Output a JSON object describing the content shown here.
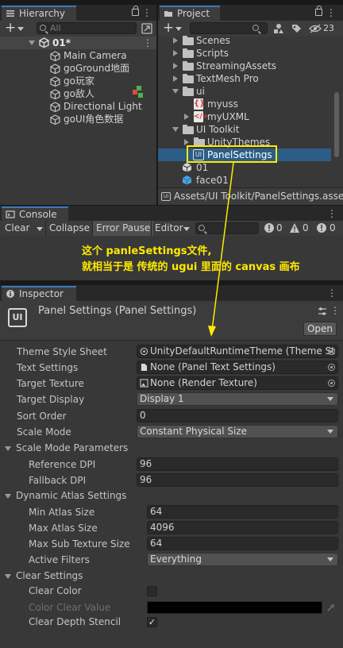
{
  "hierarchy": {
    "tab_label": "Hierarchy",
    "search_placeholder": "All",
    "scene": "01*",
    "objects": [
      {
        "label": "Main Camera"
      },
      {
        "label": "goGround地面"
      },
      {
        "label": "go玩家"
      },
      {
        "label": "go敌人"
      },
      {
        "label": "Directional Light"
      },
      {
        "label": "goUI角色数据"
      }
    ]
  },
  "project": {
    "tab_label": "Project",
    "hidden_count": "23",
    "items": [
      {
        "label": "Scenes",
        "kind": "folder"
      },
      {
        "label": "Scripts",
        "kind": "folder"
      },
      {
        "label": "StreamingAssets",
        "kind": "folder"
      },
      {
        "label": "TextMesh Pro",
        "kind": "folder"
      },
      {
        "label": "ui",
        "kind": "folder"
      },
      {
        "label": "myuss",
        "kind": "uss"
      },
      {
        "label": "myUXML",
        "kind": "uxml"
      },
      {
        "label": "UI Toolkit",
        "kind": "folder"
      },
      {
        "label": "UnityThemes",
        "kind": "folder"
      },
      {
        "label": "PanelSettings",
        "kind": "panel"
      },
      {
        "label": "01",
        "kind": "scene"
      },
      {
        "label": "face01",
        "kind": "prefab"
      }
    ],
    "path": "Assets/UI Toolkit/PanelSettings.asse"
  },
  "console": {
    "tab_label": "Console",
    "clear": "Clear",
    "collapse": "Collapse",
    "error_pause": "Error Pause",
    "editor": "Editor",
    "info_count": "0",
    "warn_count": "0",
    "error_count": "0"
  },
  "annotation": {
    "line1": "这个 panleSettings文件,",
    "line2": "就相当于是 传统的 ugui 里面的 canvas 画布",
    "color": "#ffea00"
  },
  "inspector": {
    "tab_label": "Inspector",
    "title": "Panel Settings (Panel Settings)",
    "open_button": "Open",
    "theme_style_sheet": {
      "label": "Theme Style Sheet",
      "value": "UnityDefaultRuntimeTheme (Theme St"
    },
    "text_settings": {
      "label": "Text Settings",
      "value": "None (Panel Text Settings)"
    },
    "target_texture": {
      "label": "Target Texture",
      "value": "None (Render Texture)"
    },
    "target_display": {
      "label": "Target Display",
      "value": "Display 1"
    },
    "sort_order": {
      "label": "Sort Order",
      "value": "0"
    },
    "scale_mode": {
      "label": "Scale Mode",
      "value": "Constant Physical Size"
    },
    "scale_mode_params": {
      "header": "Scale Mode Parameters",
      "reference_dpi": {
        "label": "Reference DPI",
        "value": "96"
      },
      "fallback_dpi": {
        "label": "Fallback DPI",
        "value": "96"
      }
    },
    "dynamic_atlas": {
      "header": "Dynamic Atlas Settings",
      "min_atlas_size": {
        "label": "Min Atlas Size",
        "value": "64"
      },
      "max_atlas_size": {
        "label": "Max Atlas Size",
        "value": "4096"
      },
      "max_sub_texture_size": {
        "label": "Max Sub Texture Size",
        "value": "64"
      },
      "active_filters": {
        "label": "Active Filters",
        "value": "Everything"
      }
    },
    "clear_settings": {
      "header": "Clear Settings",
      "clear_color": {
        "label": "Clear Color",
        "checked": false
      },
      "color_clear_value": {
        "label": "Color Clear Value",
        "color": "#000000"
      },
      "clear_depth_stencil": {
        "label": "Clear Depth Stencil",
        "checked": true
      }
    }
  },
  "colors": {
    "selection": "#2c5d87",
    "highlight_box": "#ffea00",
    "tab_accent": "#3a79bb"
  }
}
